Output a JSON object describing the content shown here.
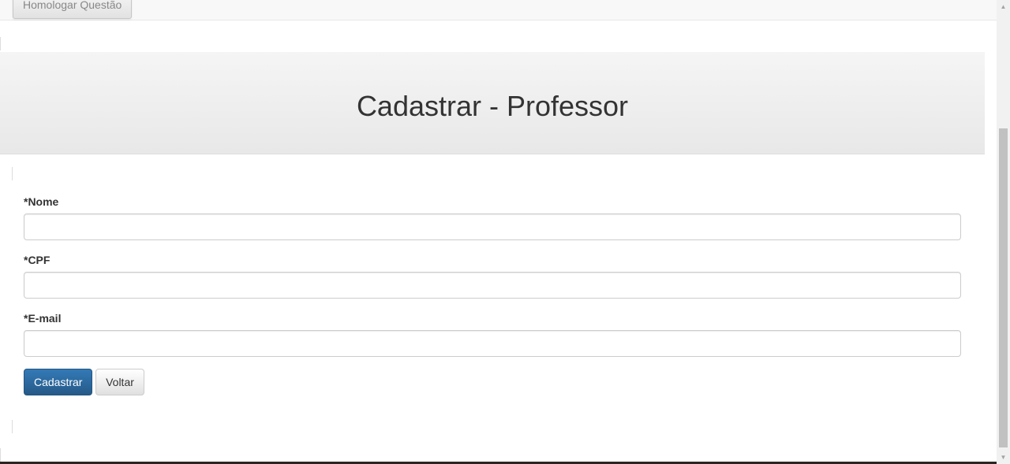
{
  "navbar": {
    "menu_button_label": "Homologar Questão"
  },
  "header": {
    "title": "Cadastrar - Professor"
  },
  "form": {
    "nome": {
      "label": "*Nome",
      "value": ""
    },
    "cpf": {
      "label": "*CPF",
      "value": ""
    },
    "email": {
      "label": "*E-mail",
      "value": ""
    }
  },
  "actions": {
    "submit_label": "Cadastrar",
    "back_label": "Voltar"
  },
  "scrollbar": {
    "up_arrow": "▲",
    "down_arrow": "▼"
  },
  "colors": {
    "primary": "#337ab7",
    "jumbotron": "#eeeeee"
  }
}
